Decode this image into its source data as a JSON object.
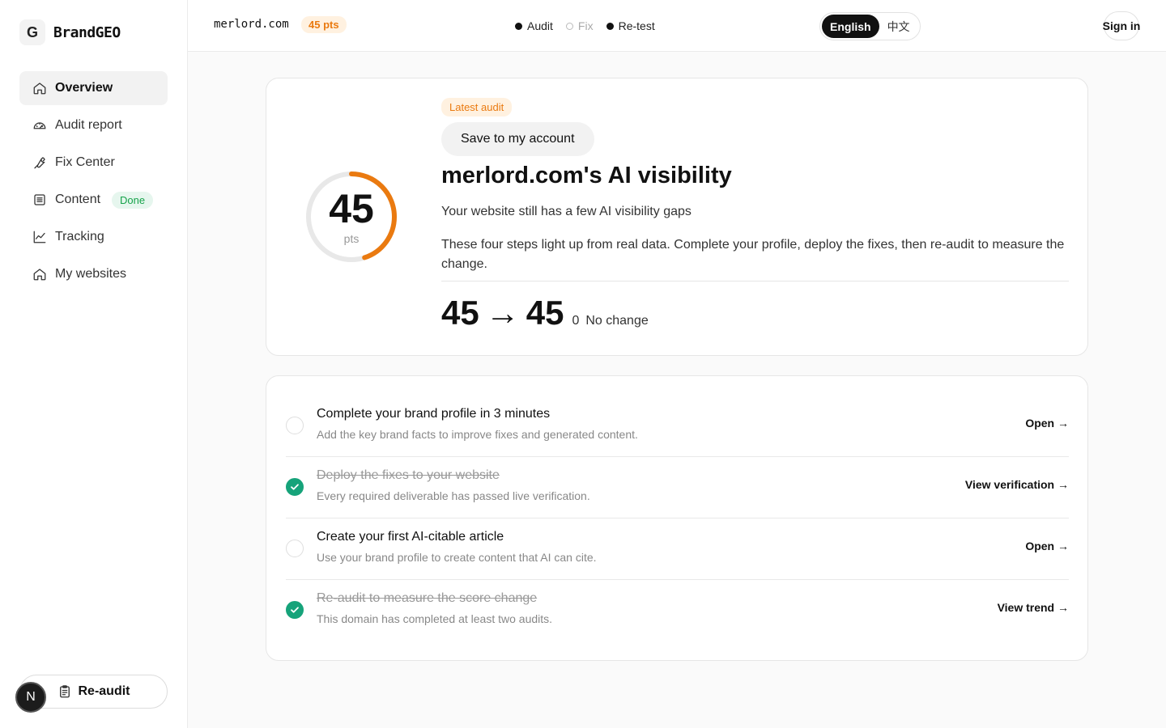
{
  "brand": {
    "logo_letter": "G",
    "name": "BrandGEO"
  },
  "sidebar": {
    "items": [
      {
        "label": "Overview",
        "icon": "home-icon"
      },
      {
        "label": "Audit report",
        "icon": "gauge-icon"
      },
      {
        "label": "Fix Center",
        "icon": "wrench-icon"
      },
      {
        "label": "Content",
        "icon": "document-icon",
        "badge": "Done"
      },
      {
        "label": "Tracking",
        "icon": "chart-line-icon"
      },
      {
        "label": "My websites",
        "icon": "home-icon"
      }
    ],
    "reaudit_label": "Re-audit",
    "avatar_letter": "N"
  },
  "header": {
    "domain": "merlord.com",
    "points": "45 pts",
    "steps": [
      {
        "label": "Audit",
        "active": true
      },
      {
        "label": "Fix",
        "active": false
      },
      {
        "label": "Re-test",
        "active": true
      }
    ],
    "languages": [
      "English",
      "中文"
    ],
    "active_language": "English",
    "signin_label": "Sign in"
  },
  "summary": {
    "score": "45",
    "score_unit": "pts",
    "score_fraction": 0.45,
    "accent_color": "#ea7a10",
    "badge": "Latest audit",
    "save_label": "Save to my account",
    "title": "merlord.com's AI visibility",
    "subtitle": "Your website still has a few AI visibility gaps",
    "description": "These four steps light up from real data. Complete your profile, deploy the fixes, then re-audit to measure the change.",
    "score_from": "45",
    "score_arrow": "→",
    "score_to": "45",
    "score_delta": "0",
    "score_change_label": "No change"
  },
  "tasks": [
    {
      "title": "Complete your brand profile in 3 minutes",
      "desc": "Add the key brand facts to improve fixes and generated content.",
      "link": "Open →",
      "done": false
    },
    {
      "title": "Deploy the fixes to your website",
      "desc": "Every required deliverable has passed live verification.",
      "link": "View verification →",
      "done": true
    },
    {
      "title": "Create your first AI-citable article",
      "desc": "Use your brand profile to create content that AI can cite.",
      "link": "Open →",
      "done": false
    },
    {
      "title": "Re-audit to measure the score change",
      "desc": "This domain has completed at least two audits.",
      "link": "View trend →",
      "done": true
    }
  ]
}
